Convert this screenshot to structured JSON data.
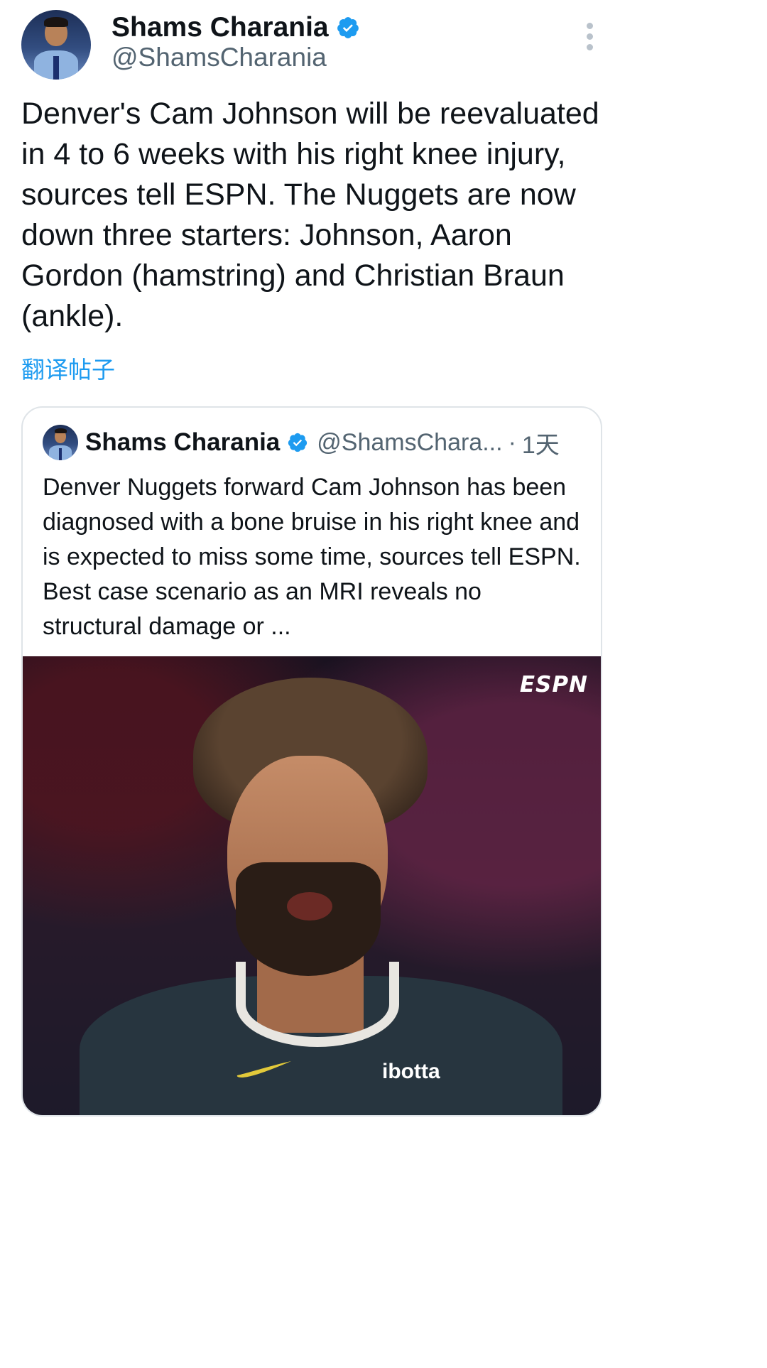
{
  "tweet": {
    "author": {
      "name": "Shams Charania",
      "handle": "@ShamsCharania",
      "verified_icon": "verified-badge-icon"
    },
    "text": "Denver's Cam Johnson will be reevaluated in 4 to 6 weeks with his right knee injury, sources tell ESPN. The Nuggets are now down three starters: Johnson, Aaron Gordon (hamstring) and Christian Braun (ankle).",
    "translate_label": "翻译帖子",
    "more_icon": "more-vertical-icon"
  },
  "quote": {
    "author": {
      "name": "Shams Charania",
      "handle": "@ShamsChara...",
      "dot": "·",
      "time": "1天"
    },
    "text": "Denver Nuggets forward Cam Johnson has been diagnosed with a bone bruise in his right knee and is expected to miss some time, sources tell ESPN. Best case scenario as an MRI reveals no structural damage or ...",
    "image": {
      "watermark": "ESPN",
      "jersey_sponsor": "ibotta"
    }
  },
  "colors": {
    "link": "#1d9bf0",
    "verified": "#1d9bf0",
    "secondary_text": "#536471",
    "border": "#dfe4e8"
  }
}
